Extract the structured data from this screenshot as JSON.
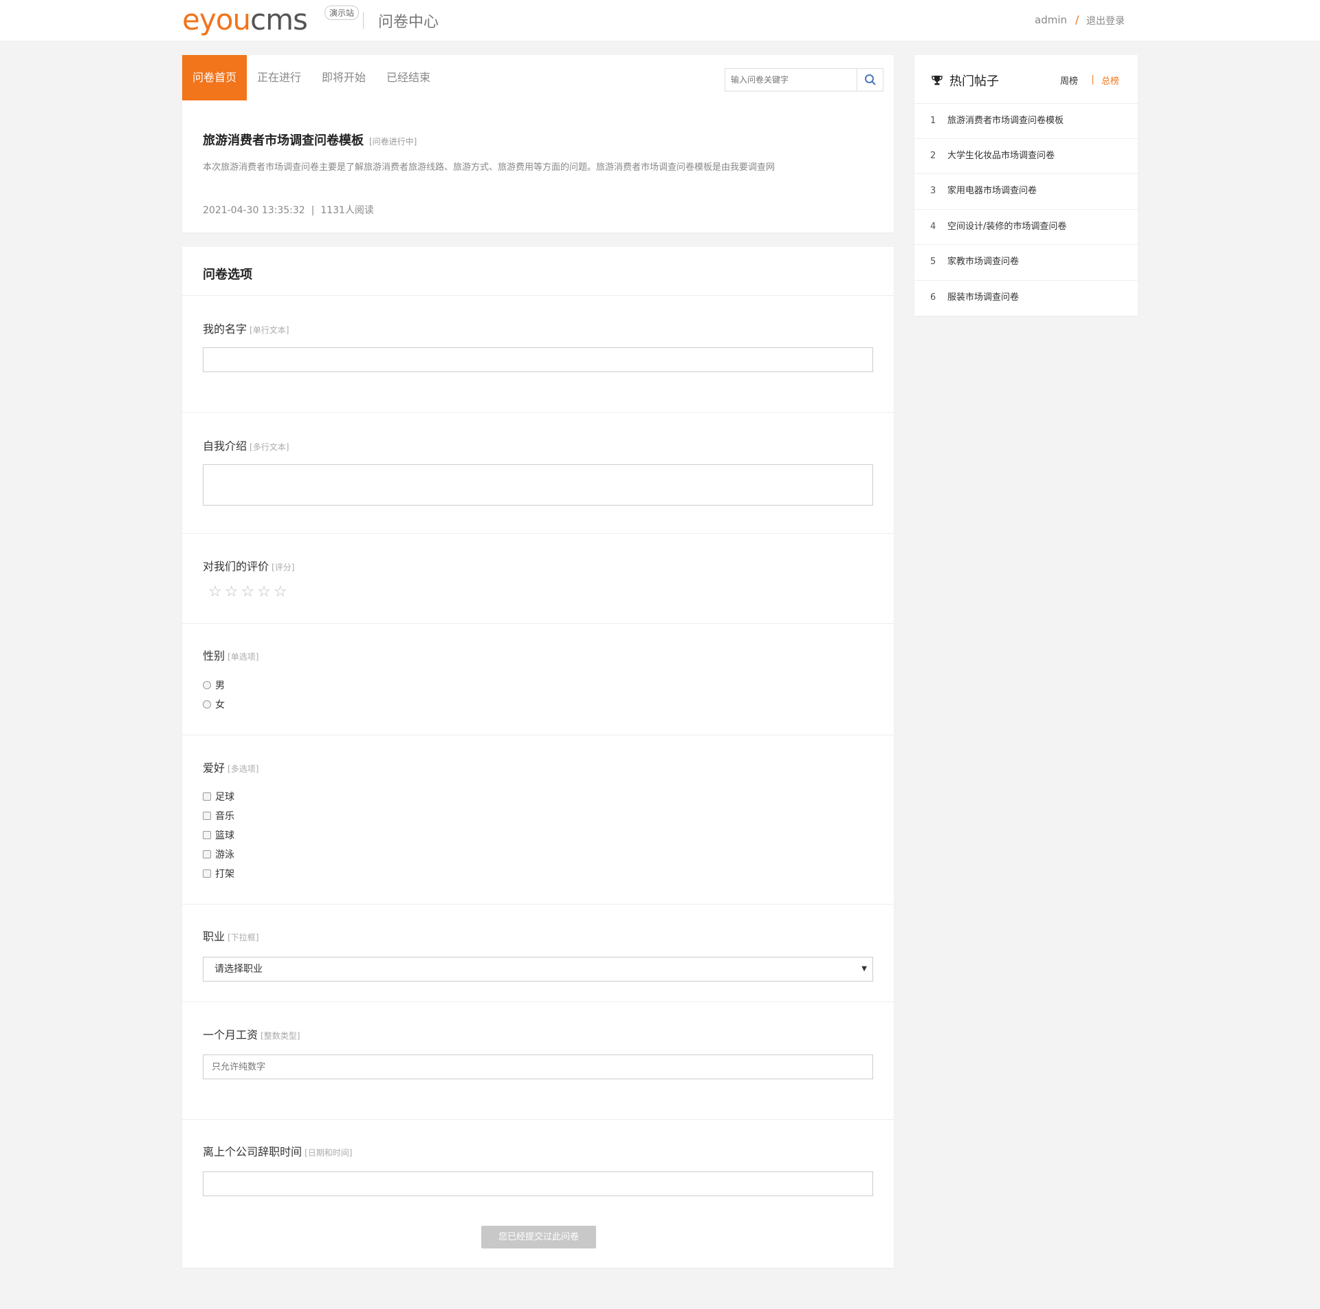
{
  "header": {
    "logo_e": "e",
    "logo_you": "you",
    "logo_cms": "cms",
    "demo_badge": "演示站",
    "title": "问卷中心",
    "user": "admin",
    "separator": "/",
    "logout": "退出登录"
  },
  "tabs": [
    {
      "label": "问卷首页",
      "active": true
    },
    {
      "label": "正在进行",
      "active": false
    },
    {
      "label": "即将开始",
      "active": false
    },
    {
      "label": "已经结束",
      "active": false
    }
  ],
  "search": {
    "placeholder": "输入问卷关键字"
  },
  "survey": {
    "title": "旅游消费者市场调查问卷模板",
    "status": "[问卷进行中]",
    "description": "本次旅游消费者市场调查问卷主要是了解旅游消费者旅游线路、旅游方式、旅游费用等方面的问题。旅游消费者市场调查问卷模板是由我要调查网",
    "meta": "2021-04-30 13:35:32  |  1131人阅读"
  },
  "form": {
    "heading": "问卷选项",
    "questions": [
      {
        "label": "我的名字",
        "type": "[单行文本]"
      },
      {
        "label": "自我介绍",
        "type": "[多行文本]"
      },
      {
        "label": "对我们的评价",
        "type": "[评分]"
      },
      {
        "label": "性别",
        "type": "[单选项]"
      },
      {
        "label": "爱好",
        "type": "[多选项]"
      },
      {
        "label": "职业",
        "type": "[下拉框]"
      },
      {
        "label": "一个月工资",
        "type": "[整数类型]"
      },
      {
        "label": "离上个公司辞职时间",
        "type": "[日期和时间]"
      }
    ],
    "rating_stars": 5,
    "rating_value": 0,
    "gender_options": [
      "男",
      "女"
    ],
    "hobby_options": [
      "足球",
      "音乐",
      "篮球",
      "游泳",
      "打架"
    ],
    "job_select": "请选择职业",
    "salary_placeholder": "只允许纯数字",
    "submit_label": "您已经提交过此问卷"
  },
  "sidebar": {
    "title": "热门帖子",
    "tab_week": "周榜",
    "tab_total": "总榜",
    "items": [
      {
        "rank": "1",
        "text": "旅游消费者市场调查问卷模板"
      },
      {
        "rank": "2",
        "text": "大学生化妆品市场调查问卷"
      },
      {
        "rank": "3",
        "text": "家用电器市场调查问卷"
      },
      {
        "rank": "4",
        "text": "空间设计/装修的市场调查问卷"
      },
      {
        "rank": "5",
        "text": "家教市场调查问卷"
      },
      {
        "rank": "6",
        "text": "服装市场调查问卷"
      }
    ]
  },
  "colors": {
    "accent": "#f2741b",
    "background": "#f3f3f3"
  }
}
